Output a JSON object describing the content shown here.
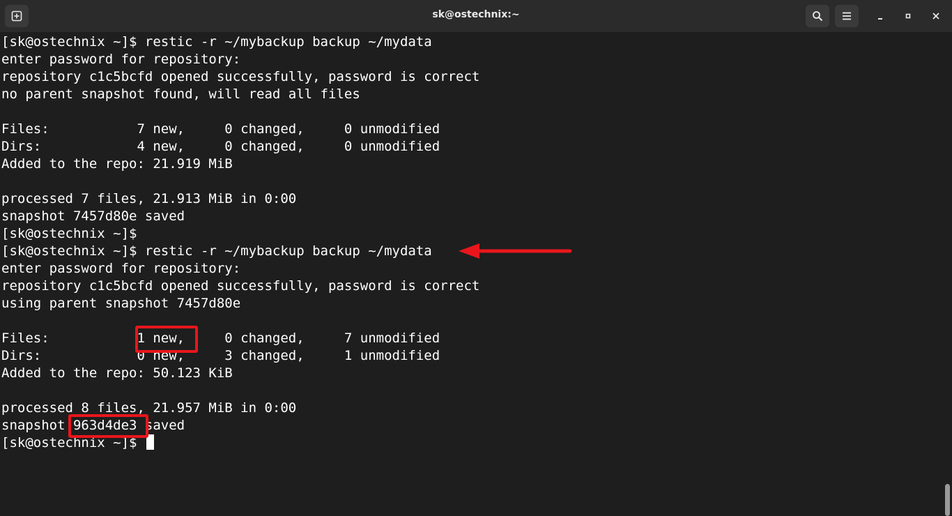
{
  "window": {
    "title": "sk@ostechnix:~"
  },
  "icons": {
    "new_tab": "new-tab-icon",
    "search": "search-icon",
    "menu": "hamburger-menu-icon",
    "minimize": "minimize-icon",
    "maximize": "maximize-icon",
    "close": "close-icon"
  },
  "colors": {
    "background": "#1e1e1e",
    "text": "#ffffff",
    "annotation": "#e8161c"
  },
  "terminal": {
    "lines": [
      "[sk@ostechnix ~]$ restic -r ~/mybackup backup ~/mydata",
      "enter password for repository:",
      "repository c1c5bcfd opened successfully, password is correct",
      "no parent snapshot found, will read all files",
      "",
      "Files:           7 new,     0 changed,     0 unmodified",
      "Dirs:            4 new,     0 changed,     0 unmodified",
      "Added to the repo: 21.919 MiB",
      "",
      "processed 7 files, 21.913 MiB in 0:00",
      "snapshot 7457d80e saved",
      "[sk@ostechnix ~]$",
      "[sk@ostechnix ~]$ restic -r ~/mybackup backup ~/mydata",
      "enter password for repository:",
      "repository c1c5bcfd opened successfully, password is correct",
      "using parent snapshot 7457d80e",
      "",
      "Files:           1 new,     0 changed,     7 unmodified",
      "Dirs:            0 new,     3 changed,     1 unmodified",
      "Added to the repo: 50.123 KiB",
      "",
      "processed 8 files, 21.957 MiB in 0:00",
      "snapshot 963d4de3 saved",
      "[sk@ostechnix ~]$ "
    ]
  }
}
